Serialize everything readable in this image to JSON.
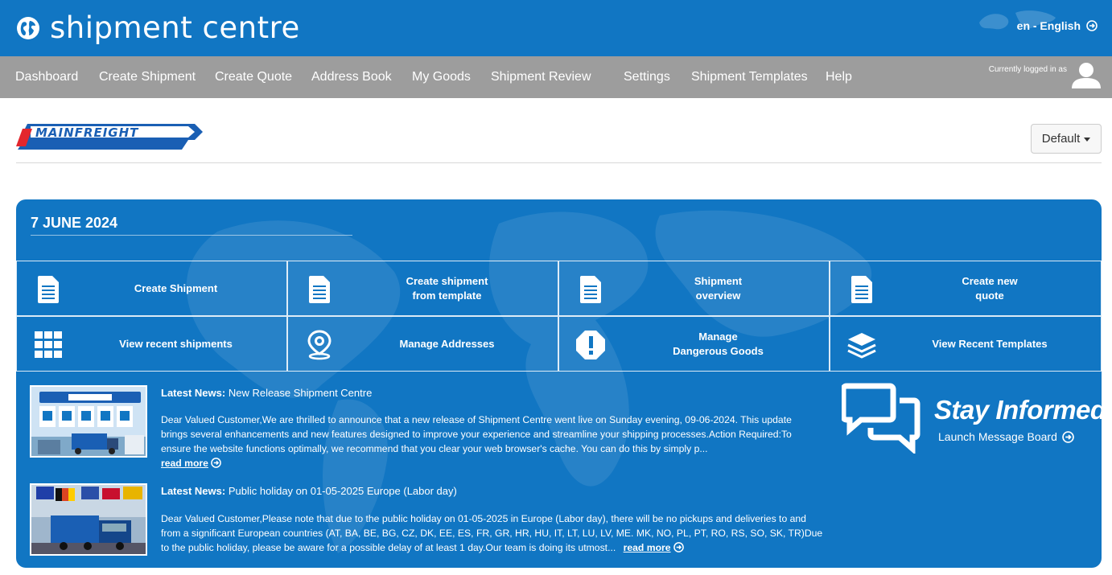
{
  "header": {
    "app_title": "shipment centre",
    "language": "en - English"
  },
  "nav": {
    "items": [
      "Dashboard",
      "Create Shipment",
      "Create Quote",
      "Address Book",
      "My Goods",
      "Shipment Review",
      "Settings",
      "Shipment Templates",
      "Help"
    ],
    "logged_in_text": "Currently logged in as"
  },
  "toolbar": {
    "view_selector": "Default"
  },
  "panel": {
    "date": "7 JUNE 2024",
    "tiles": [
      {
        "label": "Create Shipment",
        "icon": "document-icon"
      },
      {
        "label": "Create shipment\nfrom template",
        "icon": "document-icon"
      },
      {
        "label": "Shipment\noverview",
        "icon": "document-icon"
      },
      {
        "label": "Create new\nquote",
        "icon": "document-icon"
      },
      {
        "label": "View recent shipments",
        "icon": "grid-icon"
      },
      {
        "label": "Manage Addresses",
        "icon": "map-pin-icon"
      },
      {
        "label": "Manage\nDangerous Goods",
        "icon": "exclamation-icon"
      },
      {
        "label": "View Recent Templates",
        "icon": "layers-icon"
      }
    ],
    "news": [
      {
        "prefix": "Latest News:",
        "title": "New Release Shipment Centre",
        "body": "Dear Valued Customer,We are thrilled to announce that a new release of Shipment Centre went live on Sunday evening, 09-06-2024. This update brings several enhancements and new features designed to improve your experience and streamline your shipping processes.Action Required:To ensure the website functions optimally, we recommend that you clear your web browser's cache. You can do this by simply p...",
        "read_more": "read more"
      },
      {
        "prefix": "Latest News:",
        "title": "Public holiday on 01-05-2025 Europe (Labor day)",
        "body": "Dear Valued Customer,Please note that due to the public holiday on 01-05-2025 in Europe (Labor day), there will be no pickups and deliveries to and from a significant European countries (AT, BA, BE, BG, CZ, DK, EE, ES, FR, GR, HR, HU, IT, LT, LU, LV, ME. MK, NO, PL, PT, RO, RS, SO, SK, TR)Due to the public holiday, please be aware for a possible delay of at least 1 day.Our team is doing its utmost...",
        "read_more": "read more"
      }
    ],
    "stay_informed": {
      "heading": "Stay Informed",
      "link": "Launch Message Board"
    }
  },
  "colors": {
    "primary_blue": "#1176c3",
    "nav_grey": "#9d9d9d",
    "logo_red": "#e3262d",
    "logo_blue": "#1a5fb4"
  }
}
